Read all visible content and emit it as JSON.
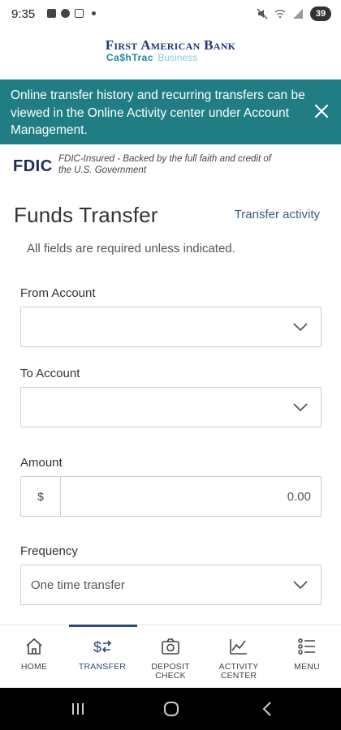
{
  "status_bar": {
    "time": "9:35",
    "battery": "39"
  },
  "logo": {
    "title": "First American Bank",
    "brand": "Ca$hTrac",
    "sub": "Business"
  },
  "banner": {
    "message": "Online transfer history and recurring transfers can be viewed in the Online Activity center under Account Management.",
    "color": "#1f7d83"
  },
  "fdic": {
    "logo": "FDIC",
    "text": "FDIC-Insured - Backed by the full faith and credit of the U.S. Government"
  },
  "main": {
    "title": "Funds Transfer",
    "transfer_activity_link": "Transfer activity",
    "required_note": "All fields are required unless indicated.",
    "from_account": {
      "label": "From Account",
      "value": ""
    },
    "to_account": {
      "label": "To Account",
      "value": ""
    },
    "amount": {
      "label": "Amount",
      "prefix": "$",
      "placeholder": "0.00"
    },
    "frequency": {
      "label": "Frequency",
      "value": "One time transfer"
    }
  },
  "bottom_nav": {
    "active": "transfer",
    "items": [
      {
        "id": "home",
        "label_line1": "HOME",
        "label_line2": "",
        "icon": "home-icon"
      },
      {
        "id": "transfer",
        "label_line1": "TRANSFER",
        "label_line2": "",
        "icon": "transfer-icon"
      },
      {
        "id": "deposit",
        "label_line1": "DEPOSIT",
        "label_line2": "CHECK",
        "icon": "camera-icon"
      },
      {
        "id": "activity",
        "label_line1": "ACTIVITY",
        "label_line2": "CENTER",
        "icon": "chart-icon"
      },
      {
        "id": "menu",
        "label_line1": "MENU",
        "label_line2": "",
        "icon": "menu-list-icon"
      }
    ]
  },
  "colors": {
    "brand_navy": "#1f3a78",
    "accent_teal": "#1f7d83",
    "active_nav": "#2d4a78"
  }
}
